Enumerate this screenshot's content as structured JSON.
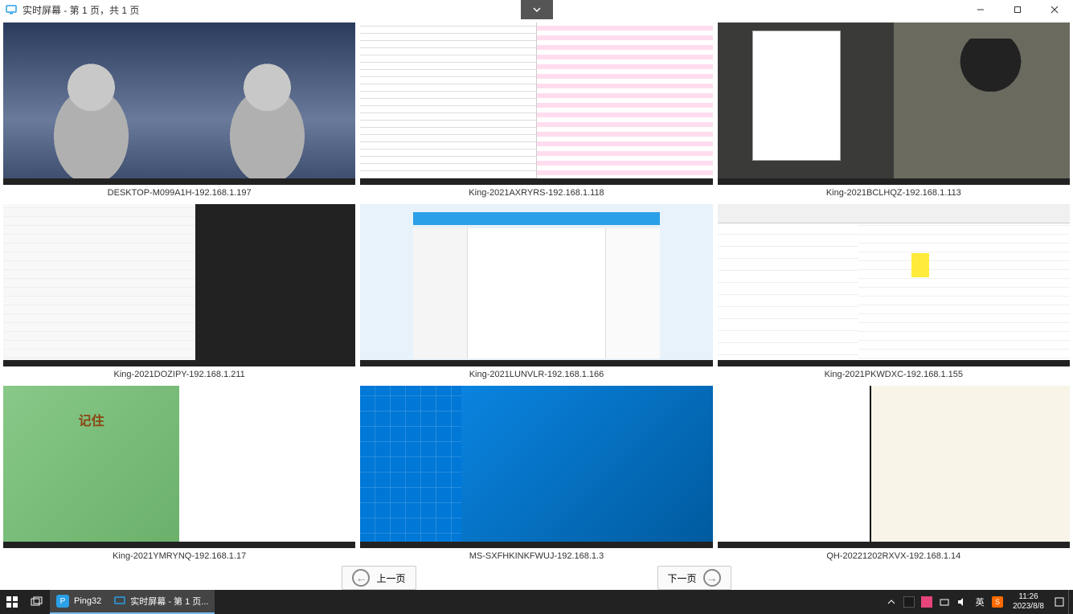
{
  "window": {
    "title": "实时屏幕 - 第 1 页，共 1 页"
  },
  "screens": [
    {
      "label": "DESKTOP-M099A1H-192.168.1.197"
    },
    {
      "label": "King-2021AXRYRS-192.168.1.118"
    },
    {
      "label": "King-2021BCLHQZ-192.168.1.113"
    },
    {
      "label": "King-2021DOZIPY-192.168.1.211"
    },
    {
      "label": "King-2021LUNVLR-192.168.1.166"
    },
    {
      "label": "King-2021PKWDXC-192.168.1.155"
    },
    {
      "label": "King-2021YMRYNQ-192.168.1.17"
    },
    {
      "label": "MS-SXFHKINKFWUJ-192.168.1.3"
    },
    {
      "label": "QH-20221202RXVX-192.168.1.14"
    }
  ],
  "pager": {
    "prev": "上一页",
    "next": "下一页"
  },
  "taskbar": {
    "app1": "Ping32",
    "app2": "实时屏幕 - 第 1 页...",
    "ime": "英",
    "time": "11:26",
    "date": "2023/8/8"
  },
  "monk_text": "记住"
}
